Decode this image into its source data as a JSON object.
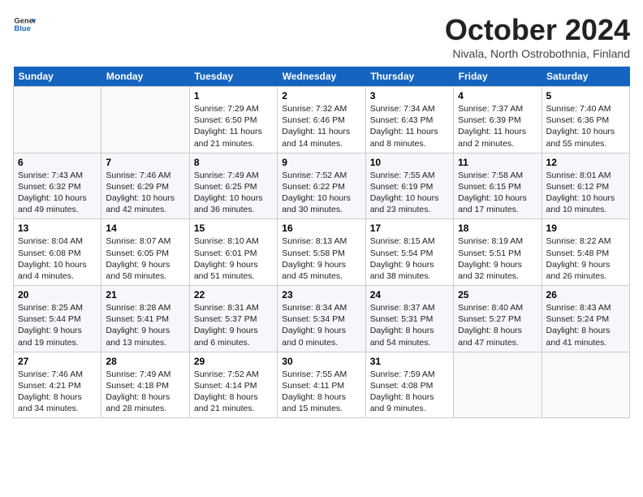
{
  "header": {
    "logo_general": "General",
    "logo_blue": "Blue",
    "month": "October 2024",
    "location": "Nivala, North Ostrobothnia, Finland"
  },
  "weekdays": [
    "Sunday",
    "Monday",
    "Tuesday",
    "Wednesday",
    "Thursday",
    "Friday",
    "Saturday"
  ],
  "weeks": [
    [
      {
        "day": "",
        "content": ""
      },
      {
        "day": "",
        "content": ""
      },
      {
        "day": "1",
        "content": "Sunrise: 7:29 AM\nSunset: 6:50 PM\nDaylight: 11 hours\nand 21 minutes."
      },
      {
        "day": "2",
        "content": "Sunrise: 7:32 AM\nSunset: 6:46 PM\nDaylight: 11 hours\nand 14 minutes."
      },
      {
        "day": "3",
        "content": "Sunrise: 7:34 AM\nSunset: 6:43 PM\nDaylight: 11 hours\nand 8 minutes."
      },
      {
        "day": "4",
        "content": "Sunrise: 7:37 AM\nSunset: 6:39 PM\nDaylight: 11 hours\nand 2 minutes."
      },
      {
        "day": "5",
        "content": "Sunrise: 7:40 AM\nSunset: 6:36 PM\nDaylight: 10 hours\nand 55 minutes."
      }
    ],
    [
      {
        "day": "6",
        "content": "Sunrise: 7:43 AM\nSunset: 6:32 PM\nDaylight: 10 hours\nand 49 minutes."
      },
      {
        "day": "7",
        "content": "Sunrise: 7:46 AM\nSunset: 6:29 PM\nDaylight: 10 hours\nand 42 minutes."
      },
      {
        "day": "8",
        "content": "Sunrise: 7:49 AM\nSunset: 6:25 PM\nDaylight: 10 hours\nand 36 minutes."
      },
      {
        "day": "9",
        "content": "Sunrise: 7:52 AM\nSunset: 6:22 PM\nDaylight: 10 hours\nand 30 minutes."
      },
      {
        "day": "10",
        "content": "Sunrise: 7:55 AM\nSunset: 6:19 PM\nDaylight: 10 hours\nand 23 minutes."
      },
      {
        "day": "11",
        "content": "Sunrise: 7:58 AM\nSunset: 6:15 PM\nDaylight: 10 hours\nand 17 minutes."
      },
      {
        "day": "12",
        "content": "Sunrise: 8:01 AM\nSunset: 6:12 PM\nDaylight: 10 hours\nand 10 minutes."
      }
    ],
    [
      {
        "day": "13",
        "content": "Sunrise: 8:04 AM\nSunset: 6:08 PM\nDaylight: 10 hours\nand 4 minutes."
      },
      {
        "day": "14",
        "content": "Sunrise: 8:07 AM\nSunset: 6:05 PM\nDaylight: 9 hours\nand 58 minutes."
      },
      {
        "day": "15",
        "content": "Sunrise: 8:10 AM\nSunset: 6:01 PM\nDaylight: 9 hours\nand 51 minutes."
      },
      {
        "day": "16",
        "content": "Sunrise: 8:13 AM\nSunset: 5:58 PM\nDaylight: 9 hours\nand 45 minutes."
      },
      {
        "day": "17",
        "content": "Sunrise: 8:15 AM\nSunset: 5:54 PM\nDaylight: 9 hours\nand 38 minutes."
      },
      {
        "day": "18",
        "content": "Sunrise: 8:19 AM\nSunset: 5:51 PM\nDaylight: 9 hours\nand 32 minutes."
      },
      {
        "day": "19",
        "content": "Sunrise: 8:22 AM\nSunset: 5:48 PM\nDaylight: 9 hours\nand 26 minutes."
      }
    ],
    [
      {
        "day": "20",
        "content": "Sunrise: 8:25 AM\nSunset: 5:44 PM\nDaylight: 9 hours\nand 19 minutes."
      },
      {
        "day": "21",
        "content": "Sunrise: 8:28 AM\nSunset: 5:41 PM\nDaylight: 9 hours\nand 13 minutes."
      },
      {
        "day": "22",
        "content": "Sunrise: 8:31 AM\nSunset: 5:37 PM\nDaylight: 9 hours\nand 6 minutes."
      },
      {
        "day": "23",
        "content": "Sunrise: 8:34 AM\nSunset: 5:34 PM\nDaylight: 9 hours\nand 0 minutes."
      },
      {
        "day": "24",
        "content": "Sunrise: 8:37 AM\nSunset: 5:31 PM\nDaylight: 8 hours\nand 54 minutes."
      },
      {
        "day": "25",
        "content": "Sunrise: 8:40 AM\nSunset: 5:27 PM\nDaylight: 8 hours\nand 47 minutes."
      },
      {
        "day": "26",
        "content": "Sunrise: 8:43 AM\nSunset: 5:24 PM\nDaylight: 8 hours\nand 41 minutes."
      }
    ],
    [
      {
        "day": "27",
        "content": "Sunrise: 7:46 AM\nSunset: 4:21 PM\nDaylight: 8 hours\nand 34 minutes."
      },
      {
        "day": "28",
        "content": "Sunrise: 7:49 AM\nSunset: 4:18 PM\nDaylight: 8 hours\nand 28 minutes."
      },
      {
        "day": "29",
        "content": "Sunrise: 7:52 AM\nSunset: 4:14 PM\nDaylight: 8 hours\nand 21 minutes."
      },
      {
        "day": "30",
        "content": "Sunrise: 7:55 AM\nSunset: 4:11 PM\nDaylight: 8 hours\nand 15 minutes."
      },
      {
        "day": "31",
        "content": "Sunrise: 7:59 AM\nSunset: 4:08 PM\nDaylight: 8 hours\nand 9 minutes."
      },
      {
        "day": "",
        "content": ""
      },
      {
        "day": "",
        "content": ""
      }
    ]
  ]
}
